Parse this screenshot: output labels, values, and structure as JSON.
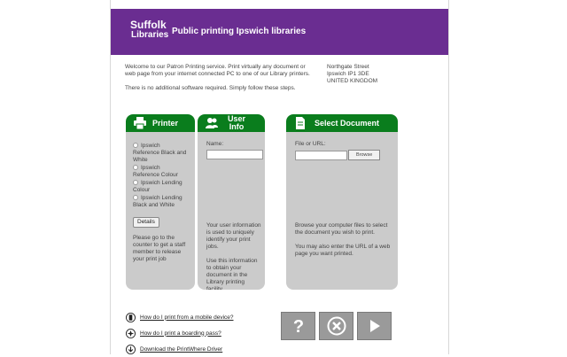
{
  "header": {
    "logo_line1": "Suffolk",
    "logo_line2": "Libraries",
    "title": "Public printing Ipswich libraries"
  },
  "intro": {
    "p1": "Welcome to our Patron Printing service. Print virtually any document or web page from your internet connected PC to one of our Library printers.",
    "p2": "There is no additional software required. Simply follow these steps."
  },
  "address": {
    "line1": "Northgate Street",
    "line2": "Ipswich    IP1 3DE",
    "line3": "UNITED KINGDOM"
  },
  "printer_panel": {
    "title": "Printer",
    "options": [
      "Ipswich Reference Black and White",
      "Ipswich Reference Colour",
      "Ipswich Lending Colour",
      "Ipswich Lending Black and White"
    ],
    "details_label": "Details",
    "note": "Please go to the counter to get a staff member to release your print job"
  },
  "user_panel": {
    "title_line1": "User",
    "title_line2": "Info",
    "name_label": "Name:",
    "name_value": "",
    "help1": "Your user information is used to uniquely identify your print jobs.",
    "help2": "Use this information to obtain your document in the Library printing facility."
  },
  "document_panel": {
    "title": "Select Document",
    "file_label": "File or URL:",
    "file_value": "",
    "browse_label": "Browse",
    "help1": "Browse your computer files to select the document you wish to print.",
    "help2": "You may also enter the URL of a web page you want printed."
  },
  "links": [
    {
      "icon": "mobile-icon",
      "label": "How do I print from a mobile device?"
    },
    {
      "icon": "boarding-pass-icon",
      "label": "How do I print a boarding pass?"
    },
    {
      "icon": "download-icon",
      "label": "Download the PrintWhere Driver"
    }
  ],
  "actions": {
    "help": "help-icon",
    "cancel": "cancel-icon",
    "next": "play-icon"
  },
  "colors": {
    "header_purple": "#6a2d91",
    "panel_green": "#0a7d1d",
    "panel_gray": "#cbcbcb",
    "action_gray": "#9a9a9a"
  }
}
